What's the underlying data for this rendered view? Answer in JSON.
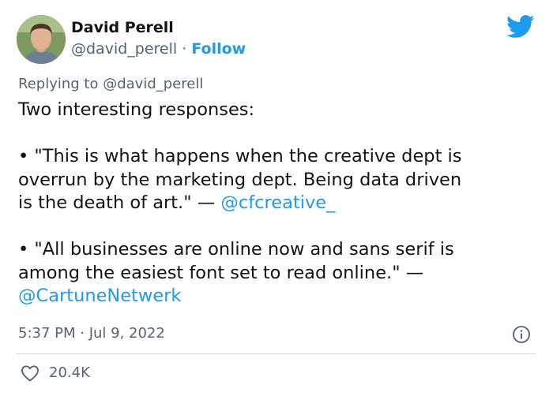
{
  "author": {
    "name": "David Perell",
    "handle": "@david_perell",
    "separator": "·",
    "follow_label": "Follow",
    "avatar_icon": "profile-photo"
  },
  "replying_to": {
    "prefix": "Replying to",
    "mention": "@david_perell"
  },
  "tweet": {
    "lines": [
      {
        "text": "Two interesting responses:"
      },
      {
        "text": ""
      },
      {
        "text": "• \"This is what happens when the creative dept is"
      },
      {
        "text": "overrun by the marketing dept. Being data driven"
      },
      {
        "text": "is the death of art.\" — ",
        "link": "@cfcreative_"
      },
      {
        "text": ""
      },
      {
        "text": "• \"All businesses are online now and sans serif is"
      },
      {
        "text": "among the easiest font set to read online.\" —"
      },
      {
        "text": "",
        "link": "@CartuneNetwerk"
      }
    ]
  },
  "timestamp": "5:37 PM · Jul 9, 2022",
  "likes": {
    "count": "20.4K",
    "icon": "heart-icon"
  },
  "colors": {
    "accent": "#1d9bf0",
    "muted": "#536471",
    "text": "#0f1419"
  }
}
